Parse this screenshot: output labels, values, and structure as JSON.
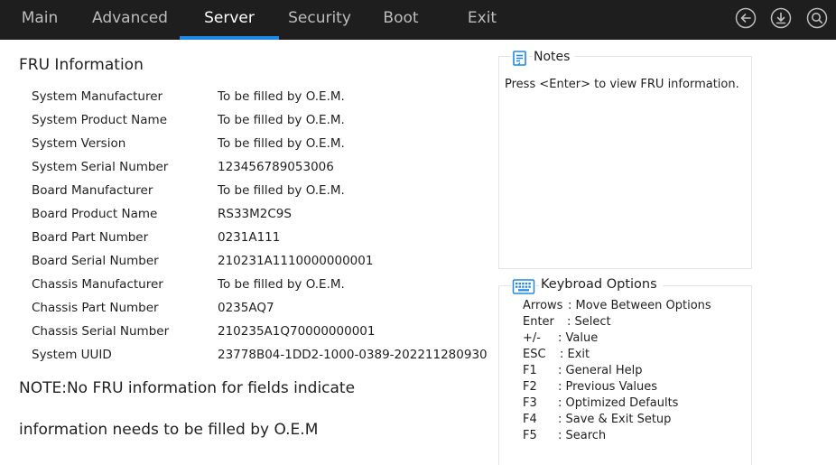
{
  "topbar": {
    "tabs": [
      {
        "label": "Main",
        "active": false
      },
      {
        "label": "Advanced",
        "active": false
      },
      {
        "label": "Server",
        "active": true
      },
      {
        "label": "Security",
        "active": false
      },
      {
        "label": "Boot",
        "active": false
      },
      {
        "label": "Exit",
        "active": false
      }
    ],
    "icons": [
      "back-icon",
      "download-icon",
      "search-icon"
    ],
    "accent_color": "#1e88e5"
  },
  "main": {
    "title": "FRU Information",
    "rows": [
      {
        "label": "System Manufacturer",
        "value": "To be filled by O.E.M."
      },
      {
        "label": "System Product Name",
        "value": "To be filled by O.E.M."
      },
      {
        "label": "System Version",
        "value": "To be filled by O.E.M."
      },
      {
        "label": "System Serial Number",
        "value": "123456789053006"
      },
      {
        "label": "Board Manufacturer",
        "value": "To be filled by O.E.M."
      },
      {
        "label": "Board Product Name",
        "value": "RS33M2C9S"
      },
      {
        "label": "Board Part Number",
        "value": "0231A111"
      },
      {
        "label": "Board Serial Number",
        "value": "210231A1110000000001"
      },
      {
        "label": "Chassis Manufacturer",
        "value": "To be filled by O.E.M."
      },
      {
        "label": "Chassis Part Number",
        "value": "0235AQ7"
      },
      {
        "label": "Chassis Serial Number",
        "value": "210235A1Q70000000001"
      },
      {
        "label": "System UUID",
        "value": "23778B04-1DD2-1000-0389-202211280930"
      }
    ],
    "note_line1": "NOTE:No FRU information for fields indicate",
    "note_line2": "information needs to be filled by O.E.M"
  },
  "notes": {
    "title": "Notes",
    "text": "Press <Enter> to view FRU information."
  },
  "keyboard": {
    "title": "Keybroad Options",
    "items": [
      {
        "key": "Arrows",
        "desc": ": Move Between Options"
      },
      {
        "key": "Enter",
        "desc": ": Select"
      },
      {
        "key": "+/-",
        "desc": ": Value"
      },
      {
        "key": "ESC",
        "desc": ": Exit"
      },
      {
        "key": "F1",
        "desc": ": General Help"
      },
      {
        "key": "F2",
        "desc": ": Previous Values"
      },
      {
        "key": "F3",
        "desc": ": Optimized Defaults"
      },
      {
        "key": "F4",
        "desc": ": Save & Exit Setup"
      },
      {
        "key": "F5",
        "desc": ": Search"
      }
    ]
  }
}
